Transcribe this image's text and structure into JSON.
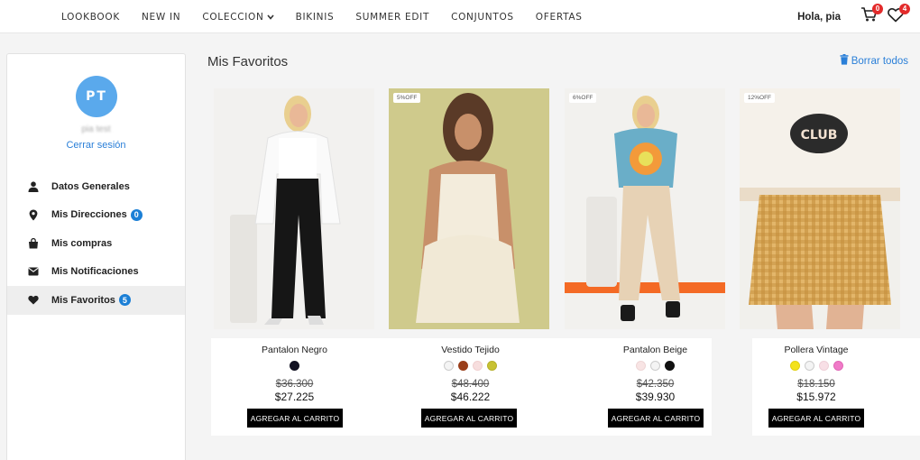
{
  "nav": {
    "items": [
      {
        "label": "LOOKBOOK"
      },
      {
        "label": "NEW IN"
      },
      {
        "label": "COLECCION"
      },
      {
        "label": "BIKINIS"
      },
      {
        "label": "SUMMER EDIT"
      },
      {
        "label": "CONJUNTOS"
      },
      {
        "label": "OFERTAS"
      }
    ],
    "greeting": "Hola, pia",
    "cart_count": "0",
    "wishlist_count": "4"
  },
  "sidebar": {
    "avatar_initials": "PT",
    "user_name": "pia test",
    "logout_label": "Cerrar sesión",
    "items": [
      {
        "label": "Datos Generales",
        "icon": "user-icon"
      },
      {
        "label": "Mis Direcciones",
        "icon": "location-pin-icon",
        "count": "0"
      },
      {
        "label": "Mis compras",
        "icon": "shopping-bag-icon"
      },
      {
        "label": "Mis Notificaciones",
        "icon": "envelope-icon"
      },
      {
        "label": "Mis Favoritos",
        "icon": "heart-icon",
        "count": "5",
        "active": true
      }
    ]
  },
  "main": {
    "title": "Mis Favoritos",
    "clear_all_label": "Borrar todos"
  },
  "products": [
    {
      "name": "Pantalon Negro",
      "discount": "",
      "old_price": "$36.300",
      "price": "$27.225",
      "swatches": [
        "#111122"
      ],
      "cta": "AGREGAR AL CARRITO"
    },
    {
      "name": "Vestido Tejido",
      "discount": "5%OFF",
      "old_price": "$48.400",
      "price": "$46.222",
      "swatches": [
        "#f4f4f4",
        "#9a3f1a",
        "#f7dede",
        "#c8c232"
      ],
      "cta": "AGREGAR AL CARRITO"
    },
    {
      "name": "Pantalon Beige",
      "discount": "6%OFF",
      "old_price": "$42.350",
      "price": "$39.930",
      "swatches": [
        "#f8e4e4",
        "#f4f4f4",
        "#111111"
      ],
      "cta": "AGREGAR AL CARRITO"
    },
    {
      "name": "Pollera Vintage",
      "discount": "12%OFF",
      "old_price": "$18.150",
      "price": "$15.972",
      "swatches": [
        "#f3e21b",
        "#f4f4f4",
        "#f8dfe6",
        "#f07ac8"
      ],
      "cta": "AGREGAR AL CARRITO"
    }
  ],
  "colors": {
    "accent": "#2a7fd8",
    "badge": "#1b7fd6",
    "alert": "#e32b2b",
    "avatar": "#5aa9ec"
  }
}
